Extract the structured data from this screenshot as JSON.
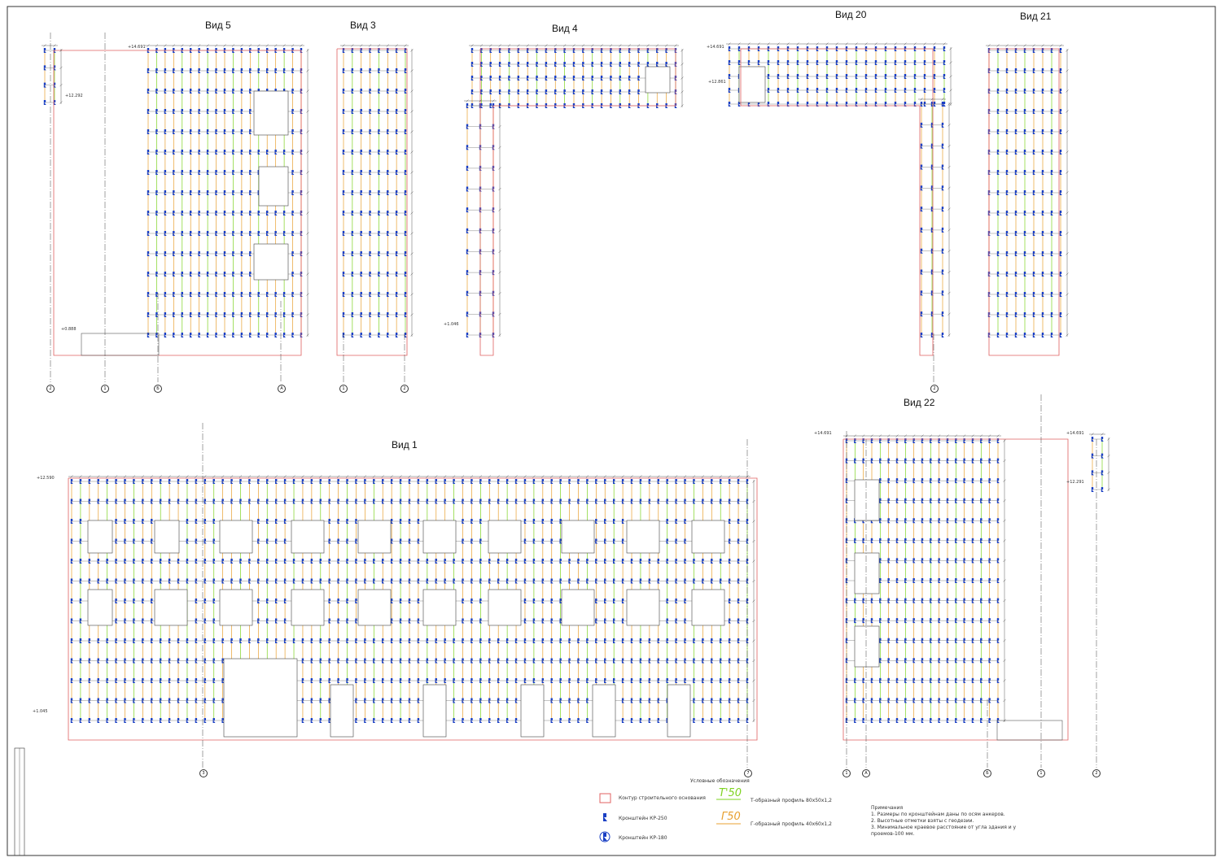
{
  "views": {
    "vid5": "Вид 5",
    "vid3": "Вид 3",
    "vid4": "Вид 4",
    "vid20": "Вид 20",
    "vid21": "Вид 21",
    "vid1": "Вид 1",
    "vid22": "Вид 22"
  },
  "axes": {
    "vid5": [
      "2",
      "1",
      "Б",
      "А"
    ],
    "vid3": [
      "1",
      "2"
    ],
    "vid20": [
      "2"
    ],
    "vid1": [
      "3",
      "7"
    ],
    "vid22": [
      "1",
      "А",
      "Б",
      "1",
      "2"
    ]
  },
  "legend": {
    "title": "Условные обозначения",
    "contour": "Контур строительного основания",
    "bracket250": "Кронштейн КР-250",
    "bracket180": "Кронштейн КР-180",
    "t_profile_mark": "Т'50",
    "t_profile": "Т-образный профиль 80х50х1,2",
    "g_profile_mark": "Г50",
    "g_profile": "Г-образный профиль 40х60х1,2"
  },
  "notes": {
    "title": "Примечания",
    "items": [
      "1.  Размеры по кронштейнам даны по осям анкеров.",
      "2.  Высотные отметки взяты с геодезии.",
      "3.  Минимальное краевое расстояние от угла здания и у",
      "     проемов-100 мм."
    ]
  },
  "elevations": {
    "vid5_top": "+14.691",
    "vid5_left": "+12.292",
    "vid5_bottom": "+0.888",
    "vid4_bottom": "+1.046",
    "vid20_top": "+14.691",
    "vid20_left": "+12.861",
    "vid1_top": "+12.590",
    "vid1_bottom": "+1.045",
    "vid22_top": "+14.691",
    "vid22_side_top": "+14.691",
    "vid22_side_bottom": "+12.291"
  },
  "colors": {
    "contour": "#e06060",
    "bracket": "#1a3fc4",
    "t_profile": "#7ed321",
    "g_profile": "#e8a030",
    "dimension": "#333333"
  }
}
